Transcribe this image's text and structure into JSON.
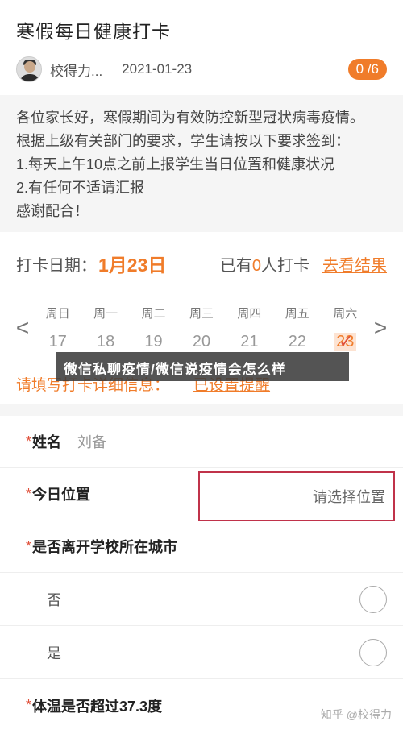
{
  "post": {
    "title": "寒假每日健康打卡",
    "author": "校得力...",
    "date": "2021-01-23",
    "badge": "0 /6"
  },
  "notice": {
    "lines": [
      "各位家长好，寒假期间为有效防控新型冠状病毒疫情。",
      "根据上级有关部门的要求，学生请按以下要求签到：",
      "1.每天上午10点之前上报学生当日位置和健康状况",
      "2.有任何不适请汇报",
      "感谢配合！"
    ]
  },
  "checkin": {
    "label": "打卡日期：",
    "date": "1月23日",
    "count_prefix": "已有",
    "count": "0",
    "count_suffix": "人打卡",
    "results_link": "去看结果"
  },
  "calendar": {
    "prev": "<",
    "next": ">",
    "days": [
      {
        "weekday": "周日",
        "num": "17"
      },
      {
        "weekday": "周一",
        "num": "18"
      },
      {
        "weekday": "周二",
        "num": "19"
      },
      {
        "weekday": "周三",
        "num": "20"
      },
      {
        "weekday": "周四",
        "num": "21"
      },
      {
        "weekday": "周五",
        "num": "22"
      },
      {
        "weekday": "周六",
        "num": "23"
      }
    ]
  },
  "banner": "微信私聊疫情/微信说疫情会怎么样",
  "fill": {
    "label": "请填写打卡详细信息：",
    "reminder": "已设置提醒"
  },
  "form": {
    "star": "*",
    "name_label": "姓名",
    "name_value": "刘备",
    "location_label": "今日位置",
    "location_placeholder": "请选择位置",
    "left_city_label": "是否离开学校所在城市",
    "option_no": "否",
    "option_yes": "是",
    "temp_label": "体温是否超过37.3度"
  },
  "watermark": "知乎 @校得力",
  "colors": {
    "accent": "#f07c2a",
    "required": "#e0503a",
    "highlight_box": "#c0324a"
  }
}
